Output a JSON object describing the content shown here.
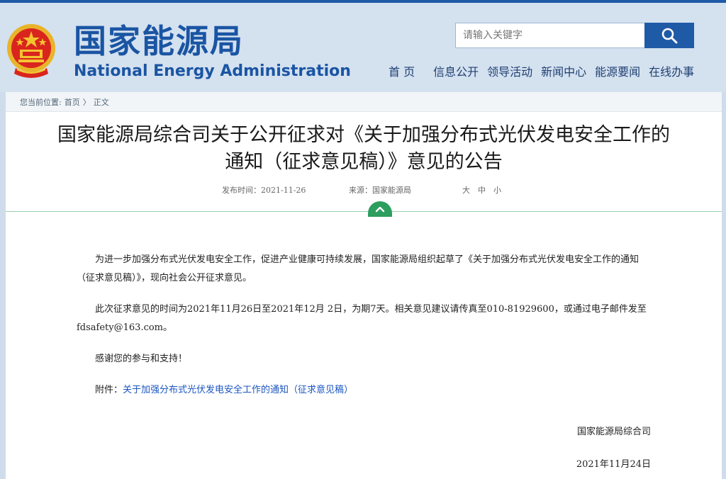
{
  "header": {
    "logo_cn": "国家能源局",
    "logo_en": "National Energy Administration",
    "search_placeholder": "请输入关键字",
    "nav": [
      "首 页",
      "信息公开",
      "领导活动",
      "新闻中心",
      "能源要闻",
      "在线办事"
    ]
  },
  "breadcrumb": {
    "prefix": "您当前位置:",
    "home": "首页",
    "sep": "〉",
    "current": "正文"
  },
  "article": {
    "title_line1": "国家能源局综合司关于公开征求对《关于加强分布式光伏发电安全工作的",
    "title_line2": "通知（征求意见稿）》意见的公告",
    "publish_time": "发布时间：2021-11-26",
    "source": "来源：国家能源局",
    "font_large": "大",
    "font_medium": "中",
    "font_small": "小",
    "para1": "为进一步加强分布式光伏发电安全工作，促进产业健康可持续发展，国家能源局组织起草了《关于加强分布式光伏发电安全工作的通知（征求意见稿）》，现向社会公开征求意见。",
    "para2": "此次征求意见的时间为2021年11月26日至2021年12月 2日，为期7天。相关意见建议请传真至010-81929600，或通过电子邮件发至fdsafety@163.com。",
    "para3": "感谢您的参与和支持！",
    "attachment_label": "附件：",
    "attachment_link": "关于加强分布式光伏发电安全工作的通知（征求意见稿）",
    "signature": "国家能源局综合司",
    "date": "2021年11月24日"
  }
}
